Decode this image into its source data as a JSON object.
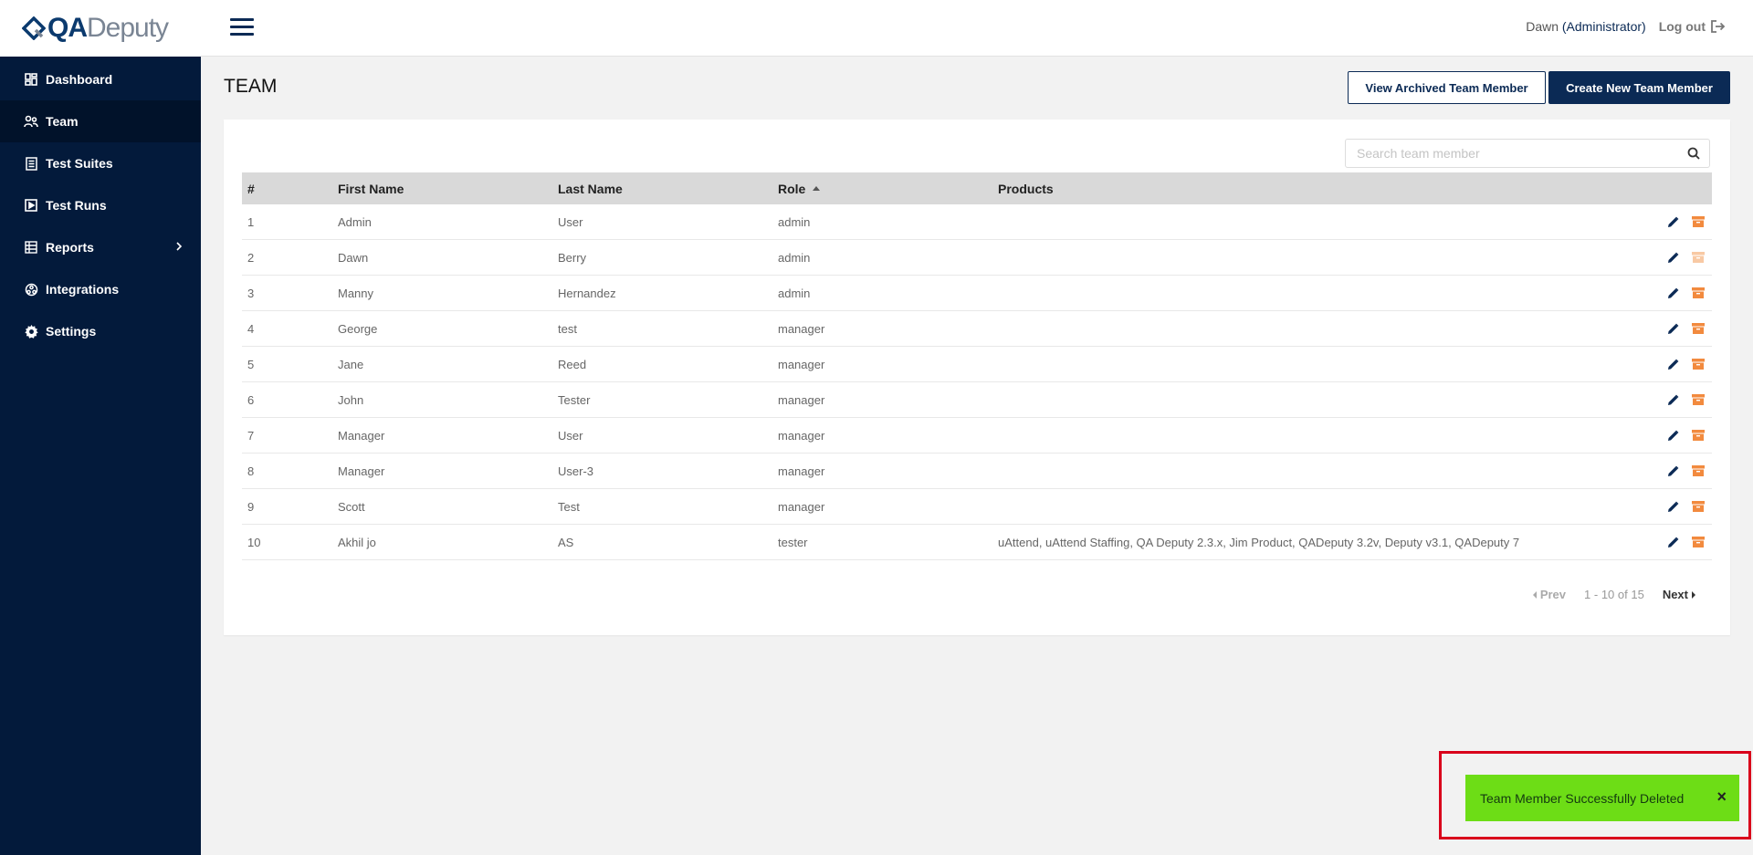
{
  "app": {
    "logo_qa": "QA",
    "logo_deputy": "Deputy",
    "brand_color": "#0b2a55",
    "accent_orange": "#f28a3e"
  },
  "sidebar": {
    "items": [
      {
        "label": "Dashboard",
        "icon": "dashboard-icon"
      },
      {
        "label": "Team",
        "icon": "team-icon",
        "active": true
      },
      {
        "label": "Test Suites",
        "icon": "test-suites-icon"
      },
      {
        "label": "Test Runs",
        "icon": "test-runs-icon"
      },
      {
        "label": "Reports",
        "icon": "reports-icon",
        "has_submenu": true
      },
      {
        "label": "Integrations",
        "icon": "integrations-icon"
      },
      {
        "label": "Settings",
        "icon": "gear-icon"
      }
    ]
  },
  "header": {
    "user_name": "Dawn",
    "user_role": "(Administrator)",
    "logout_label": "Log out"
  },
  "page": {
    "title": "TEAM",
    "view_archived_label": "View Archived Team Member",
    "create_new_label": "Create New Team Member",
    "search_placeholder": "Search team member"
  },
  "table": {
    "columns": [
      "#",
      "First Name",
      "Last Name",
      "Role",
      "Products"
    ],
    "sorted_column": "Role",
    "rows": [
      {
        "num": "1",
        "first": "Admin",
        "last": "User",
        "role": "admin",
        "products": "",
        "archive_disabled": false
      },
      {
        "num": "2",
        "first": "Dawn",
        "last": "Berry",
        "role": "admin",
        "products": "",
        "archive_disabled": true
      },
      {
        "num": "3",
        "first": "Manny",
        "last": "Hernandez",
        "role": "admin",
        "products": "",
        "archive_disabled": false
      },
      {
        "num": "4",
        "first": "George",
        "last": "test",
        "role": "manager",
        "products": "",
        "archive_disabled": false
      },
      {
        "num": "5",
        "first": "Jane",
        "last": "Reed",
        "role": "manager",
        "products": "",
        "archive_disabled": false
      },
      {
        "num": "6",
        "first": "John",
        "last": "Tester",
        "role": "manager",
        "products": "",
        "archive_disabled": false
      },
      {
        "num": "7",
        "first": "Manager",
        "last": "User",
        "role": "manager",
        "products": "",
        "archive_disabled": false
      },
      {
        "num": "8",
        "first": "Manager",
        "last": "User-3",
        "role": "manager",
        "products": "",
        "archive_disabled": false
      },
      {
        "num": "9",
        "first": "Scott",
        "last": "Test",
        "role": "manager",
        "products": "",
        "archive_disabled": false
      },
      {
        "num": "10",
        "first": "Akhil jo",
        "last": "AS",
        "role": "tester",
        "products": "uAttend, uAttend Staffing, QA Deputy 2.3.x, Jim Product, QADeputy 3.2v, Deputy v3.1, QADeputy 7",
        "archive_disabled": false
      }
    ]
  },
  "pager": {
    "prev_label": "Prev",
    "info": "1 - 10 of 15",
    "next_label": "Next"
  },
  "toast": {
    "message": "Team Member Successfully Deleted",
    "close_label": "×",
    "color": "#6ddd16"
  }
}
